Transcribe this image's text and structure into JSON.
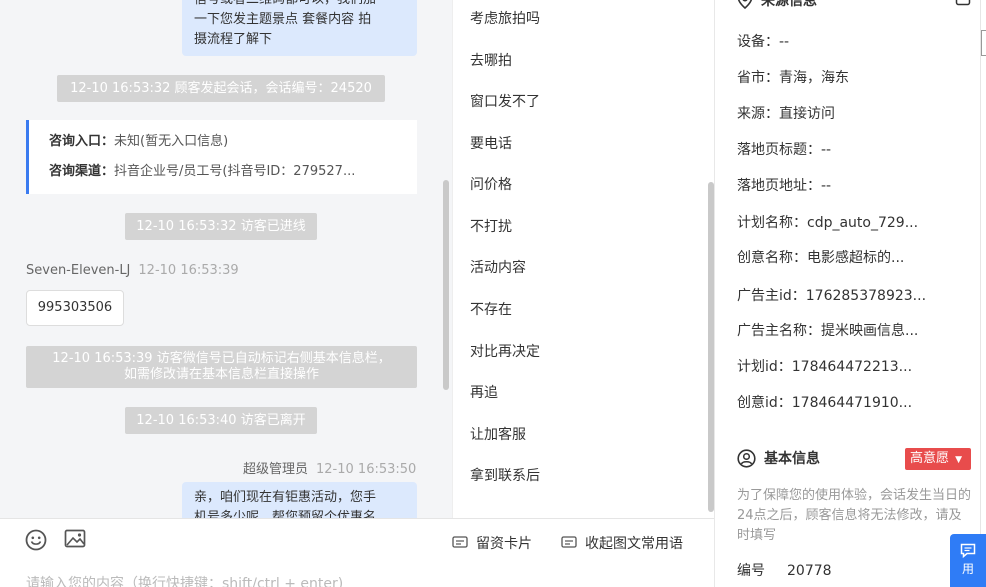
{
  "chat": {
    "top_bubble": {
      "line1": "信号或者二维码都可以，我们加",
      "line2": "一下您发主题景点 套餐内容 拍",
      "line3": "摄流程了解下"
    },
    "sys_start": "12-10 16:53:32 顾客发起会话，会话编号：24520",
    "consult_card": {
      "entry_label": "咨询入口：",
      "entry_value": "未知(暂无入口信息)",
      "channel_label": "咨询渠道：",
      "channel_value": "抖音企业号/员工号(抖音号ID：279527..."
    },
    "sys_entered": "12-10 16:53:32 访客已进线",
    "visitor_name": "Seven-Eleven-LJ",
    "visitor_time": "12-10 16:53:39",
    "visitor_msg": "995303506",
    "sys_wechat_line1": "12-10 16:53:39 访客微信号已自动标记右侧基本信息栏，",
    "sys_wechat_line2": "如需修改请在基本信息栏直接操作",
    "sys_left": "12-10 16:53:40 访客已离开",
    "admin_name": "超级管理员",
    "admin_time": "12-10 16:53:50",
    "admin_bubble": {
      "line1": "亲，咱们现在有钜惠活动，您手",
      "line2": "机号多少呢，帮您预留个优惠名"
    }
  },
  "quick_replies": [
    "考虑旅拍吗",
    "去哪拍",
    "窗口发不了",
    "要电话",
    "问价格",
    "不打扰",
    "活动内容",
    "不存在",
    "对比再决定",
    "再追",
    "让加客服",
    "拿到联系后"
  ],
  "info": {
    "source_header": "来源信息",
    "device": "设备：--",
    "province": "省市：青海，海东",
    "source": "来源：直接访问",
    "landing_title": "落地页标题：--",
    "landing_url": "落地页地址：--",
    "plan_name": "计划名称：cdp_auto_729...",
    "creative_name": "创意名称：电影感超标的...",
    "advertiser_id": "广告主id：176285378923...",
    "advertiser_name": "广告主名称：提米映画信息...",
    "plan_id": "计划id：178464472213...",
    "creative_id": "创意id：178464471910...",
    "basic_header": "基本信息",
    "intent_badge": "高意愿",
    "notice": "为了保障您的使用体验，会话发生当日的24点之后，顾客信息将无法修改，请及时填写",
    "serial_label": "编号",
    "serial_value": "20778"
  },
  "float_button": "用",
  "input": {
    "card_button": "留资卡片",
    "collapse_button": "收起图文常用语",
    "placeholder": "请输入您的内容（换行快捷键：shift/ctrl + enter)"
  },
  "colors": {
    "accent": "#3a7bf0",
    "badge": "#e84c4c",
    "bubble": "#dce9fd",
    "system": "#d4d4d4"
  }
}
